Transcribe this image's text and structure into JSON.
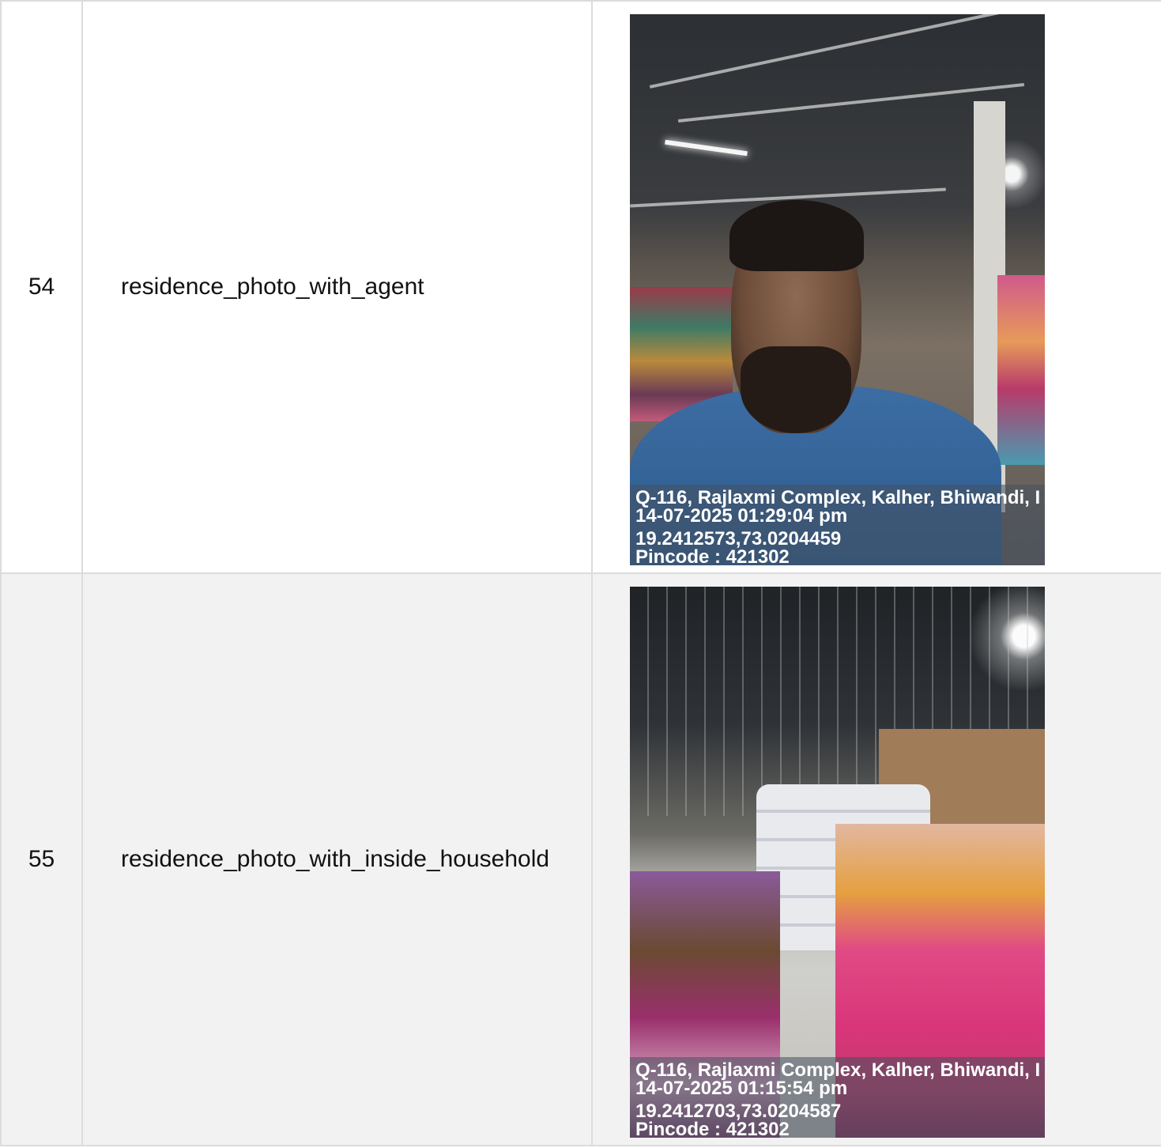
{
  "rows": [
    {
      "index": "54",
      "field": "residence_photo_with_agent",
      "photo": {
        "subject": "agent selfie inside textile warehouse",
        "caption": {
          "address": "Q-116, Rajlaxmi Complex, Kalher, Bhiwandi, I",
          "datetime": "14-07-2025 01:29:04 pm",
          "coordinates": "19.2412573,73.0204459",
          "pincode": "Pincode : 421302"
        }
      }
    },
    {
      "index": "55",
      "field": "residence_photo_with_inside_household",
      "photo": {
        "subject": "warehouse interior with stacked fabric bales",
        "caption": {
          "address": "Q-116, Rajlaxmi Complex, Kalher, Bhiwandi, I",
          "datetime": "14-07-2025 01:15:54 pm",
          "coordinates": "19.2412703,73.0204587",
          "pincode": "Pincode : 421302"
        }
      }
    }
  ],
  "colors": {
    "border": "#dcdcdc",
    "row_alt": "#f2f2f2",
    "text": "#111111"
  }
}
